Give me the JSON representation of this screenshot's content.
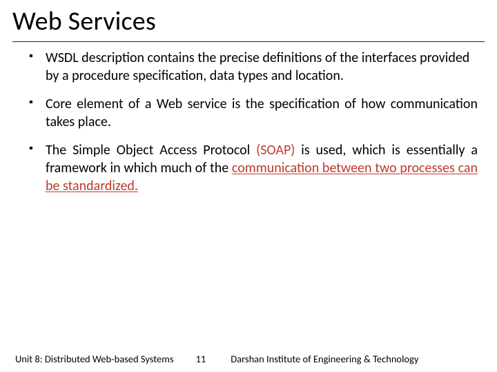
{
  "title": "Web Services",
  "bullets": [
    {
      "segments": [
        {
          "text": "WSDL description contains the precise definitions of the interfaces provided by a procedure specification, data types and location.",
          "cls": ""
        }
      ],
      "justify": false
    },
    {
      "segments": [
        {
          "text": "Core element of a Web service is the specification of how communication takes place.",
          "cls": ""
        }
      ],
      "justify": true
    },
    {
      "segments": [
        {
          "text": "The Simple Object Access Protocol ",
          "cls": ""
        },
        {
          "text": "(SOAP)",
          "cls": "red"
        },
        {
          "text": " is used, which is essentially a framework in which much of the ",
          "cls": ""
        },
        {
          "text": "communication between two processes can be standardized.",
          "cls": "red red-line"
        }
      ],
      "justify": true
    }
  ],
  "footer": {
    "unit": "Unit 8: Distributed Web-based Systems",
    "page": "11",
    "institute": "Darshan Institute of Engineering & Technology"
  }
}
